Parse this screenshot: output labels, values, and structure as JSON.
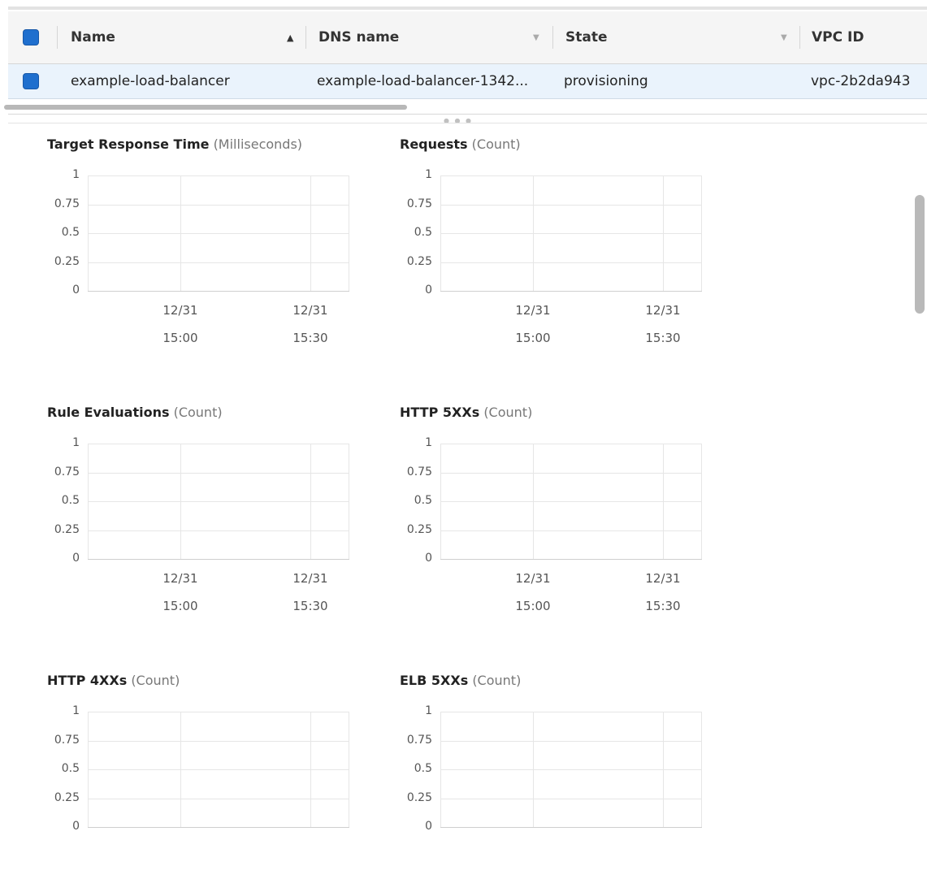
{
  "table": {
    "columns": [
      {
        "label": "Name",
        "sort": "ascending"
      },
      {
        "label": "DNS name",
        "sort": "none"
      },
      {
        "label": "State",
        "sort": "none"
      },
      {
        "label": "VPC ID",
        "sort": "none"
      }
    ],
    "rows": [
      {
        "name": "example-load-balancer",
        "dns": "example-load-balancer-1342...",
        "state": "provisioning",
        "vpc": "vpc-2b2da943",
        "selected": true
      }
    ]
  },
  "colors": {
    "checkbox": "#1f6fce",
    "selected_row": "#eaf3fc"
  },
  "y_ticks": [
    "1",
    "0.75",
    "0.5",
    "0.25",
    "0"
  ],
  "x_ticks": [
    {
      "date": "12/31",
      "time": "15:00"
    },
    {
      "date": "12/31",
      "time": "15:30"
    }
  ],
  "charts": [
    {
      "title": "Target Response Time",
      "unit": "(Milliseconds)"
    },
    {
      "title": "Requests",
      "unit": "(Count)"
    },
    {
      "title": "Rule Evaluations",
      "unit": "(Count)"
    },
    {
      "title": "HTTP 5XXs",
      "unit": "(Count)"
    },
    {
      "title": "HTTP 4XXs",
      "unit": "(Count)"
    },
    {
      "title": "ELB 5XXs",
      "unit": "(Count)"
    }
  ],
  "chart_data": [
    {
      "type": "line",
      "title": "Target Response Time (Milliseconds)",
      "x": [
        "12/31 15:00",
        "12/31 15:30"
      ],
      "series": [],
      "ylim": [
        0,
        1
      ],
      "grid": true
    },
    {
      "type": "line",
      "title": "Requests (Count)",
      "x": [
        "12/31 15:00",
        "12/31 15:30"
      ],
      "series": [],
      "ylim": [
        0,
        1
      ],
      "grid": true
    },
    {
      "type": "line",
      "title": "Rule Evaluations (Count)",
      "x": [
        "12/31 15:00",
        "12/31 15:30"
      ],
      "series": [],
      "ylim": [
        0,
        1
      ],
      "grid": true
    },
    {
      "type": "line",
      "title": "HTTP 5XXs (Count)",
      "x": [
        "12/31 15:00",
        "12/31 15:30"
      ],
      "series": [],
      "ylim": [
        0,
        1
      ],
      "grid": true
    },
    {
      "type": "line",
      "title": "HTTP 4XXs (Count)",
      "x": [],
      "series": [],
      "ylim": [
        0,
        1
      ],
      "grid": true
    },
    {
      "type": "line",
      "title": "ELB 5XXs (Count)",
      "x": [],
      "series": [],
      "ylim": [
        0,
        1
      ],
      "grid": true
    }
  ]
}
